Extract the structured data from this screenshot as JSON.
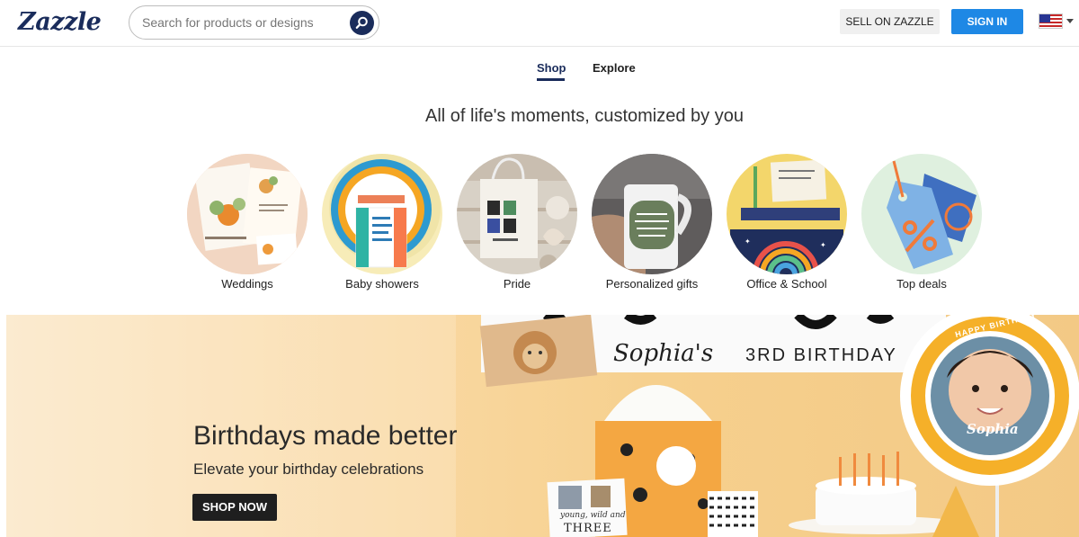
{
  "header": {
    "logo": "Zazzle",
    "search_placeholder": "Search for products or designs",
    "sell_label": "SELL ON ZAZZLE",
    "signin_label": "SIGN IN"
  },
  "tabs": [
    {
      "label": "Shop",
      "active": true
    },
    {
      "label": "Explore",
      "active": false
    }
  ],
  "headline": "All of life's moments, customized by you",
  "categories": [
    {
      "label": "Weddings"
    },
    {
      "label": "Baby showers"
    },
    {
      "label": "Pride"
    },
    {
      "label": "Personalized gifts"
    },
    {
      "label": "Office & School"
    },
    {
      "label": "Top deals"
    }
  ],
  "hero": {
    "title": "Birthdays made better",
    "subtitle": "Elevate your birthday celebrations",
    "button_label": "SHOP NOW",
    "banner_name": "Sophia's",
    "banner_text": "3RD BIRTHDAY",
    "balloon_name": "Sophia",
    "balloon_ring": "HAPPY BIRTHDAY",
    "card_text_1": "young, wild and",
    "card_text_2": "THREE"
  },
  "colors": {
    "brand": "#1a2c5b",
    "signin": "#1e88e5",
    "hero_bg": "#f9d79f"
  }
}
